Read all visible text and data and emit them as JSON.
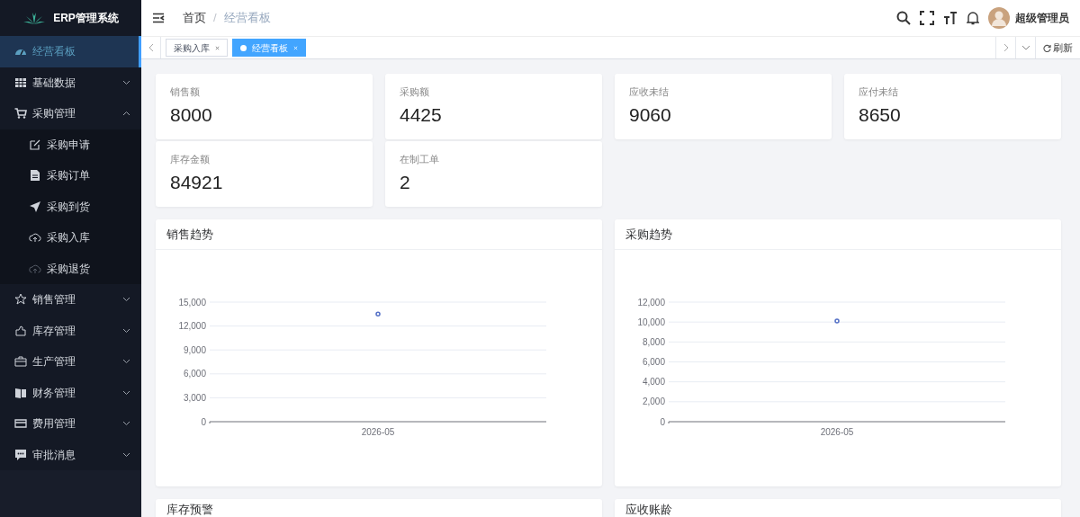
{
  "app": {
    "title": "ERP管理系统"
  },
  "sidebar": {
    "items": [
      {
        "kind": "link",
        "label": "经营看板",
        "selected": true
      },
      {
        "kind": "menu",
        "label": "基础数据",
        "expanded": false,
        "selected": false
      },
      {
        "kind": "menu",
        "label": "采购管理",
        "expanded": true,
        "selected": false,
        "children": [
          {
            "label": "采购申请",
            "selected": false
          },
          {
            "label": "采购订单",
            "selected": false
          },
          {
            "label": "采购到货",
            "selected": false
          },
          {
            "label": "采购入库",
            "selected": false
          },
          {
            "label": "采购退货",
            "selected": false
          }
        ]
      },
      {
        "kind": "menu",
        "label": "销售管理",
        "expanded": false,
        "selected": false
      },
      {
        "kind": "menu",
        "label": "库存管理",
        "expanded": false,
        "selected": false
      },
      {
        "kind": "menu",
        "label": "生产管理",
        "expanded": false,
        "selected": false
      },
      {
        "kind": "menu",
        "label": "财务管理",
        "expanded": false,
        "selected": false
      },
      {
        "kind": "menu",
        "label": "费用管理",
        "expanded": false,
        "selected": false
      },
      {
        "kind": "menu",
        "label": "审批消息",
        "expanded": false,
        "selected": false
      }
    ]
  },
  "breadcrumb": {
    "separator": "/",
    "items": [
      "首页",
      "经营看板"
    ]
  },
  "user": {
    "name": "超级管理员"
  },
  "tabs": [
    {
      "label": "采购入库",
      "selected": false
    },
    {
      "label": "经营看板",
      "selected": true
    }
  ],
  "refresh_label": "刷新",
  "stats": [
    {
      "label": "销售额",
      "value": "8000"
    },
    {
      "label": "采购额",
      "value": "4425"
    },
    {
      "label": "应收未结",
      "value": "9060"
    },
    {
      "label": "应付未结",
      "value": "8650"
    },
    {
      "label": "库存金额",
      "value": "84921"
    },
    {
      "label": "在制工单",
      "value": "2"
    }
  ],
  "charts": [
    {
      "title": "销售趋势",
      "chart_data": {
        "type": "line",
        "categories": [
          "2026-05"
        ],
        "grid": true,
        "series": [
          {
            "color": "#5470c6",
            "marker": "circle",
            "values": [
              13500
            ]
          }
        ],
        "ylim": [
          0,
          15000
        ],
        "yticks": [
          {
            "value": 0,
            "label": "0"
          },
          {
            "value": 3000,
            "label": "3,000"
          },
          {
            "value": 6000,
            "label": "6,000"
          },
          {
            "value": 9000,
            "label": "9,000"
          },
          {
            "value": 12000,
            "label": "12,000"
          },
          {
            "value": 15000,
            "label": "15,000"
          }
        ]
      }
    },
    {
      "title": "采购趋势",
      "chart_data": {
        "type": "line",
        "categories": [
          "2026-05"
        ],
        "grid": true,
        "series": [
          {
            "color": "#5470c6",
            "marker": "circle",
            "values": [
              10100
            ]
          }
        ],
        "ylim": [
          0,
          12000
        ],
        "yticks": [
          {
            "value": 0,
            "label": "0"
          },
          {
            "value": 2000,
            "label": "2,000"
          },
          {
            "value": 4000,
            "label": "4,000"
          },
          {
            "value": 6000,
            "label": "6,000"
          },
          {
            "value": 8000,
            "label": "8,000"
          },
          {
            "value": 10000,
            "label": "10,000"
          },
          {
            "value": 12000,
            "label": "12,000"
          }
        ]
      }
    }
  ],
  "bottom_panels": [
    {
      "title": "库存预警"
    },
    {
      "title": "应收账龄"
    }
  ]
}
